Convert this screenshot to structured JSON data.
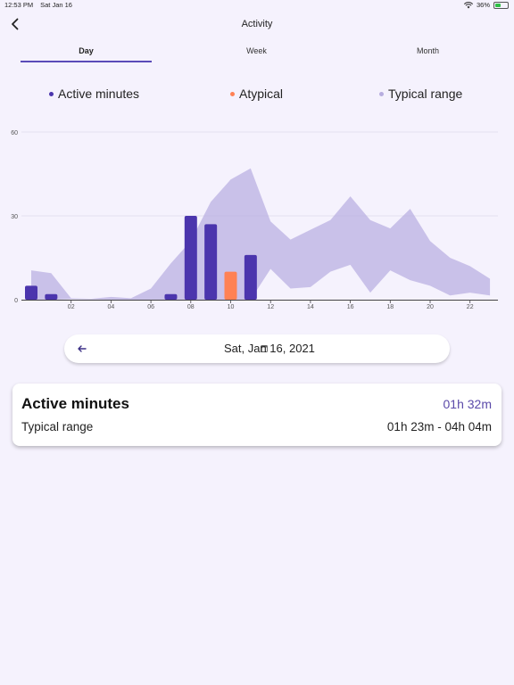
{
  "status_bar": {
    "time": "12:53 PM",
    "date": "Sat Jan 16",
    "battery": "36%"
  },
  "nav": {
    "title": "Activity"
  },
  "tabs": [
    {
      "label": "Day",
      "active": true
    },
    {
      "label": "Week",
      "active": false
    },
    {
      "label": "Month",
      "active": false
    }
  ],
  "legend": [
    {
      "label": "Active minutes",
      "color": "#4b35ad"
    },
    {
      "label": "Atypical",
      "color": "#ff8154"
    },
    {
      "label": "Typical range",
      "color": "#b7addf"
    }
  ],
  "date_picker": {
    "label": "Sat, Jan 16, 2021"
  },
  "summary": {
    "title": "Active minutes",
    "value": "01h 32m",
    "range_label": "Typical range",
    "range_value": "01h 23m - 04h 04m"
  },
  "chart_data": {
    "type": "bar",
    "ylim": [
      0,
      60
    ],
    "y_ticks": [
      "0",
      "30",
      "60"
    ],
    "x_ticks": [
      "02",
      "04",
      "06",
      "08",
      "10",
      "12",
      "14",
      "16",
      "18",
      "20",
      "22"
    ],
    "grid": true,
    "bars": [
      {
        "hour": 0,
        "value": 5,
        "atypical": false
      },
      {
        "hour": 1,
        "value": 2,
        "atypical": false
      },
      {
        "hour": 7,
        "value": 2,
        "atypical": false
      },
      {
        "hour": 8,
        "value": 30,
        "atypical": false
      },
      {
        "hour": 9,
        "value": 27,
        "atypical": false
      },
      {
        "hour": 10,
        "value": 10,
        "atypical": true
      },
      {
        "hour": 11,
        "value": 16,
        "atypical": false
      }
    ],
    "typical_range": {
      "x": [
        0,
        1,
        2,
        3,
        4,
        5,
        6,
        7,
        8,
        9,
        10,
        11,
        12,
        13,
        14,
        15,
        16,
        17,
        18,
        19,
        20,
        21,
        22,
        23
      ],
      "upper": [
        10.5,
        9.5,
        0.5,
        0.3,
        1,
        0.5,
        4,
        13,
        21,
        35,
        43,
        47,
        28,
        21.5,
        25,
        28.5,
        37,
        28.5,
        25.5,
        32.5,
        21,
        15,
        12,
        7.5
      ],
      "lower": [
        0,
        0,
        0.2,
        0.1,
        0,
        0,
        0,
        0,
        0,
        0,
        0,
        0,
        11,
        4,
        4.5,
        10,
        12.5,
        2.5,
        10.5,
        7,
        5,
        1.5,
        2.5,
        1.5
      ]
    }
  }
}
